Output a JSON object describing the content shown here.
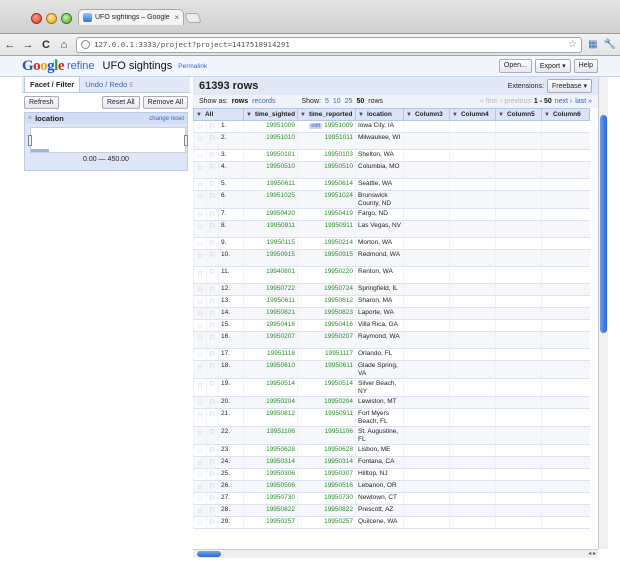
{
  "browser": {
    "tab_title": "UFO sightings – Google Refi",
    "tab_close": "×",
    "url": "127.0.0.1:3333/project?project=1417518914291",
    "nav_back": "←",
    "nav_forward": "→",
    "nav_reload": "C",
    "nav_home": "⌂",
    "bookmark_star": "☆",
    "wrench": "🔧",
    "extension_icon": "▦"
  },
  "header": {
    "logo_g1": "G",
    "logo_o1": "o",
    "logo_o2": "o",
    "logo_g2": "g",
    "logo_l": "l",
    "logo_e": "e",
    "logo_refine": "refine",
    "project_name": "UFO sightings",
    "permalink": "Permalink",
    "open": "Open...",
    "export": "Export ▾",
    "help": "Help"
  },
  "left": {
    "tab_facet": "Facet / Filter",
    "tab_undo": "Undo / Redo",
    "undo_count": "5",
    "refresh": "Refresh",
    "reset_all": "Reset All",
    "remove_all": "Remove All",
    "facet": {
      "close": "×",
      "title": "location",
      "links": "change reset",
      "range": "0.00 — 450.00"
    }
  },
  "right": {
    "rows_count": "61393 rows",
    "extensions_label": "Extensions:",
    "extensions_value": "Freebase ▾",
    "show_as": "Show as:",
    "show_rows": "rows",
    "show_records": "records",
    "show_label": "Show:",
    "size_5": "5",
    "size_10": "10",
    "size_25": "25",
    "size_50": "50",
    "size_rows": "rows",
    "first": "« first",
    "previous": "‹ previous",
    "range": "1 - 50",
    "next": "next ›",
    "last": "last »",
    "edit_chip": "edit",
    "columns": [
      "All",
      "time_sighted",
      "time_reported",
      "location",
      "Column3",
      "Column4",
      "Column5",
      "Column6"
    ],
    "rows": [
      {
        "n": "1.",
        "sighted": "19951009",
        "reported": "19951009",
        "loc": "Iowa City, IA"
      },
      {
        "n": "2.",
        "sighted": "19951010",
        "reported": "19951011",
        "loc": "Milwaukee, WI"
      },
      {
        "n": "3.",
        "sighted": "19950101",
        "reported": "19950103",
        "loc": "Shelton, WA"
      },
      {
        "n": "4.",
        "sighted": "19950510",
        "reported": "19950510",
        "loc": "Columbia, MO"
      },
      {
        "n": "5.",
        "sighted": "19950611",
        "reported": "19950614",
        "loc": "Seattle, WA"
      },
      {
        "n": "6.",
        "sighted": "19951025",
        "reported": "19951024",
        "loc": "Brunswick County, ND"
      },
      {
        "n": "7.",
        "sighted": "19950420",
        "reported": "19950419",
        "loc": "Fargo, ND"
      },
      {
        "n": "8.",
        "sighted": "19950911",
        "reported": "19950911",
        "loc": "Las Vegas, NV"
      },
      {
        "n": "9.",
        "sighted": "19950115",
        "reported": "19950214",
        "loc": "Morton, WA"
      },
      {
        "n": "10.",
        "sighted": "19950915",
        "reported": "19950915",
        "loc": "Redmond, WA"
      },
      {
        "n": "11.",
        "sighted": "19940801",
        "reported": "19950220",
        "loc": "Renton, WA"
      },
      {
        "n": "12.",
        "sighted": "19950722",
        "reported": "19950724",
        "loc": "Springfield, IL"
      },
      {
        "n": "13.",
        "sighted": "19950611",
        "reported": "19950612",
        "loc": "Sharon, MA"
      },
      {
        "n": "14.",
        "sighted": "19950821",
        "reported": "19950823",
        "loc": "Laporte, WA"
      },
      {
        "n": "15.",
        "sighted": "19950416",
        "reported": "19950416",
        "loc": "Villa Rica, GA"
      },
      {
        "n": "16.",
        "sighted": "19950207",
        "reported": "19950207",
        "loc": "Raymond, WA"
      },
      {
        "n": "17.",
        "sighted": "19951118",
        "reported": "19951117",
        "loc": "Orlando, FL"
      },
      {
        "n": "18.",
        "sighted": "19950610",
        "reported": "19950611",
        "loc": "Glade Spring, VA"
      },
      {
        "n": "19.",
        "sighted": "19950514",
        "reported": "19950514",
        "loc": "Silver Beach, NY"
      },
      {
        "n": "20.",
        "sighted": "19950204",
        "reported": "19950204",
        "loc": "Lewiston, MT"
      },
      {
        "n": "21.",
        "sighted": "19950812",
        "reported": "19950911",
        "loc": "Fort Myers Beach, FL"
      },
      {
        "n": "22.",
        "sighted": "19951106",
        "reported": "19951106",
        "loc": "St. Augustine, FL"
      },
      {
        "n": "23.",
        "sighted": "19950628",
        "reported": "19950628",
        "loc": "Lisbon, ME"
      },
      {
        "n": "24.",
        "sighted": "19950314",
        "reported": "19950314",
        "loc": "Fontana, CA"
      },
      {
        "n": "25.",
        "sighted": "19950306",
        "reported": "19950307",
        "loc": "Hilltop, NJ"
      },
      {
        "n": "26.",
        "sighted": "19950506",
        "reported": "19950516",
        "loc": "Lebanon, OR"
      },
      {
        "n": "27.",
        "sighted": "19950730",
        "reported": "19950730",
        "loc": "Newtown, CT"
      },
      {
        "n": "28.",
        "sighted": "19950822",
        "reported": "19950822",
        "loc": "Prescott, AZ"
      },
      {
        "n": "29.",
        "sighted": "19950257",
        "reported": "19950257",
        "loc": "Quilcene, WA"
      }
    ]
  }
}
